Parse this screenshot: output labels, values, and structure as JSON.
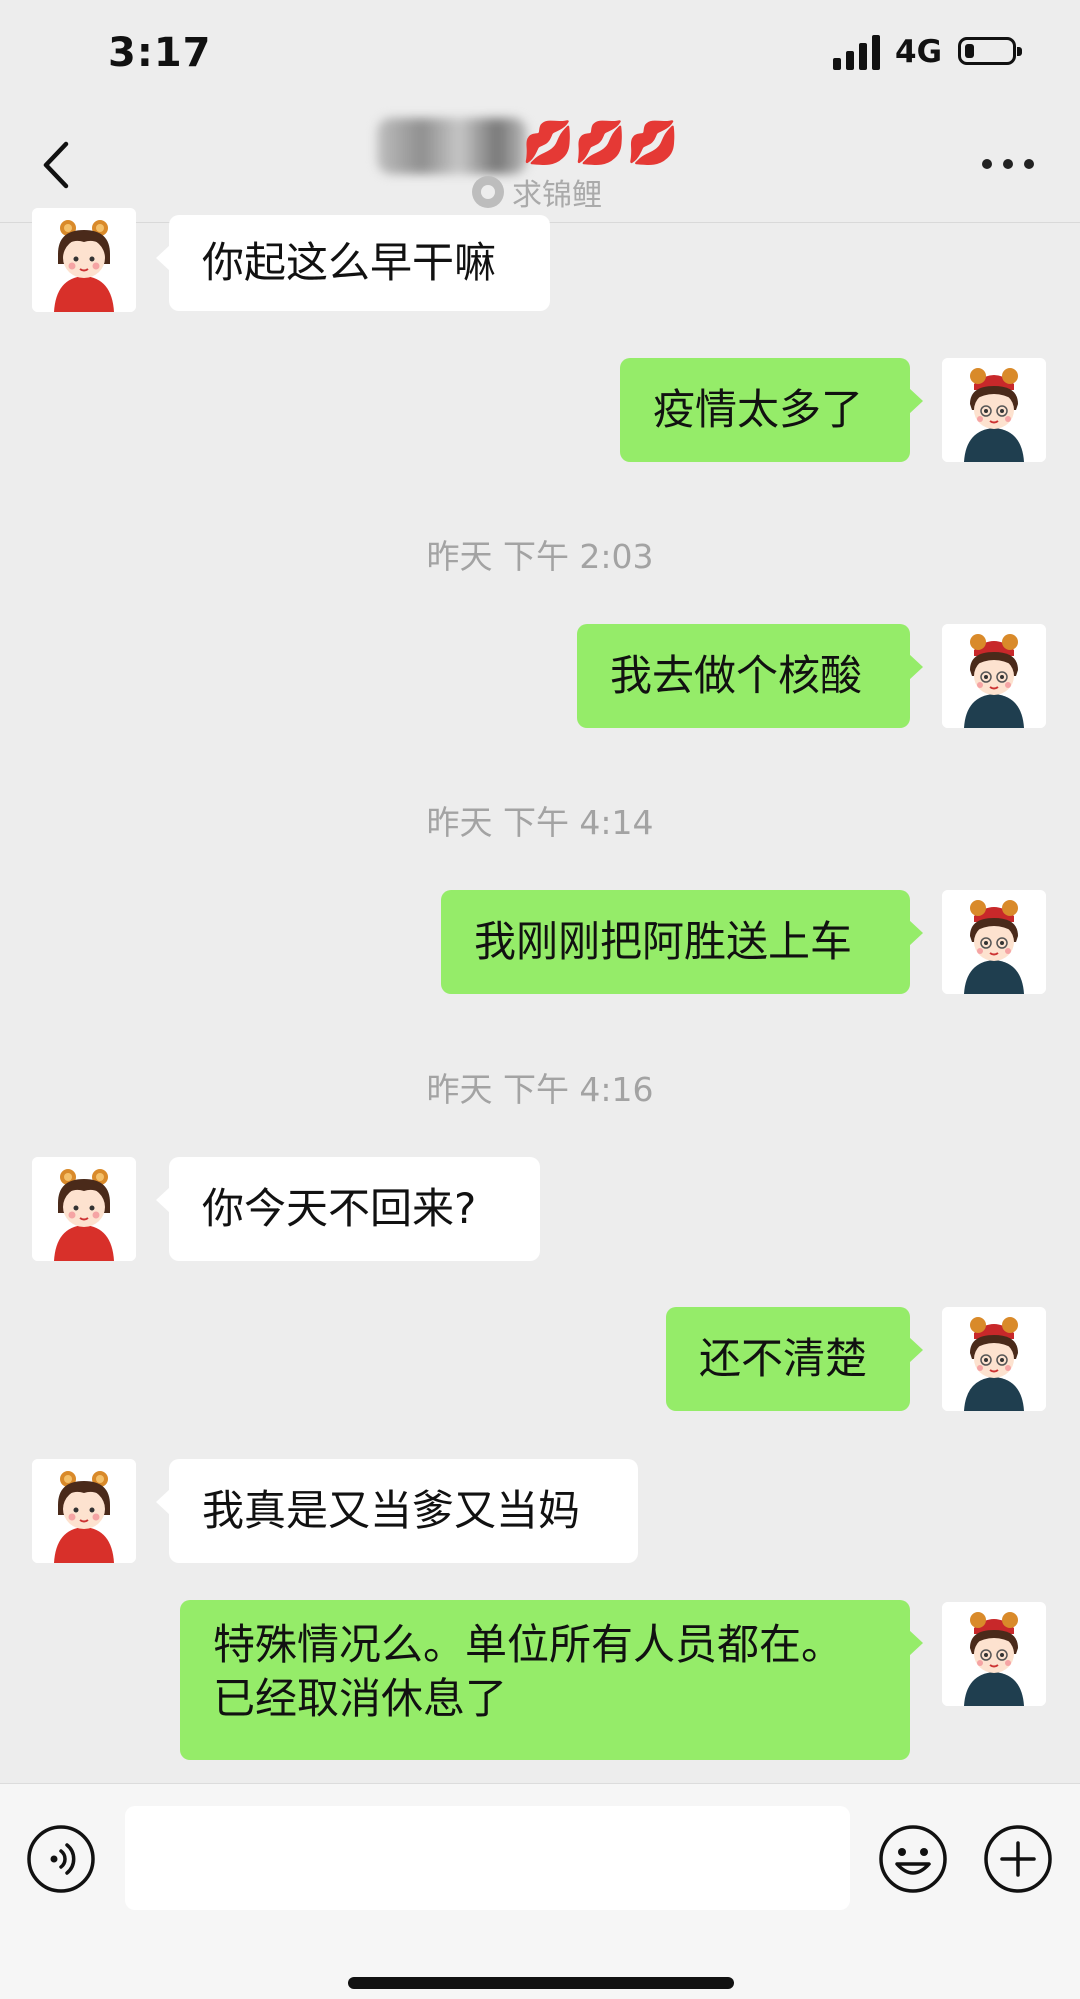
{
  "status_bar": {
    "time": "3:17",
    "network": "4G",
    "signal_bars": 4,
    "battery_level": 0.2
  },
  "nav": {
    "title_emoji": "💋💋💋",
    "subtitle": "求锦鲤",
    "back_icon": "chevron-left-icon",
    "more_icon": "more-dots-icon"
  },
  "messages": [
    {
      "side": "left",
      "text": "你起这么早干嘛"
    },
    {
      "side": "right",
      "text": "疫情太多了"
    },
    {
      "type": "time",
      "text": "昨天 下午 2:03"
    },
    {
      "side": "right",
      "text": "我去做个核酸"
    },
    {
      "type": "time",
      "text": "昨天 下午 4:14"
    },
    {
      "side": "right",
      "text": "我刚刚把阿胜送上车"
    },
    {
      "type": "time",
      "text": "昨天 下午 4:16"
    },
    {
      "side": "left",
      "text": "你今天不回来?"
    },
    {
      "side": "right",
      "text": "还不清楚"
    },
    {
      "side": "left",
      "text": "我真是又当爹又当妈"
    },
    {
      "side": "right",
      "lines": [
        "特殊情况么。单位所有人员都在。",
        "已经取消休息了"
      ]
    }
  ],
  "input_bar": {
    "placeholder": "",
    "voice_icon": "voice-icon",
    "emoji_icon": "emoji-icon",
    "plus_icon": "plus-icon"
  },
  "colors": {
    "background": "#ededed",
    "bubble_self": "#95ec69",
    "bubble_other": "#ffffff",
    "timestamp": "#a3a3a3"
  }
}
